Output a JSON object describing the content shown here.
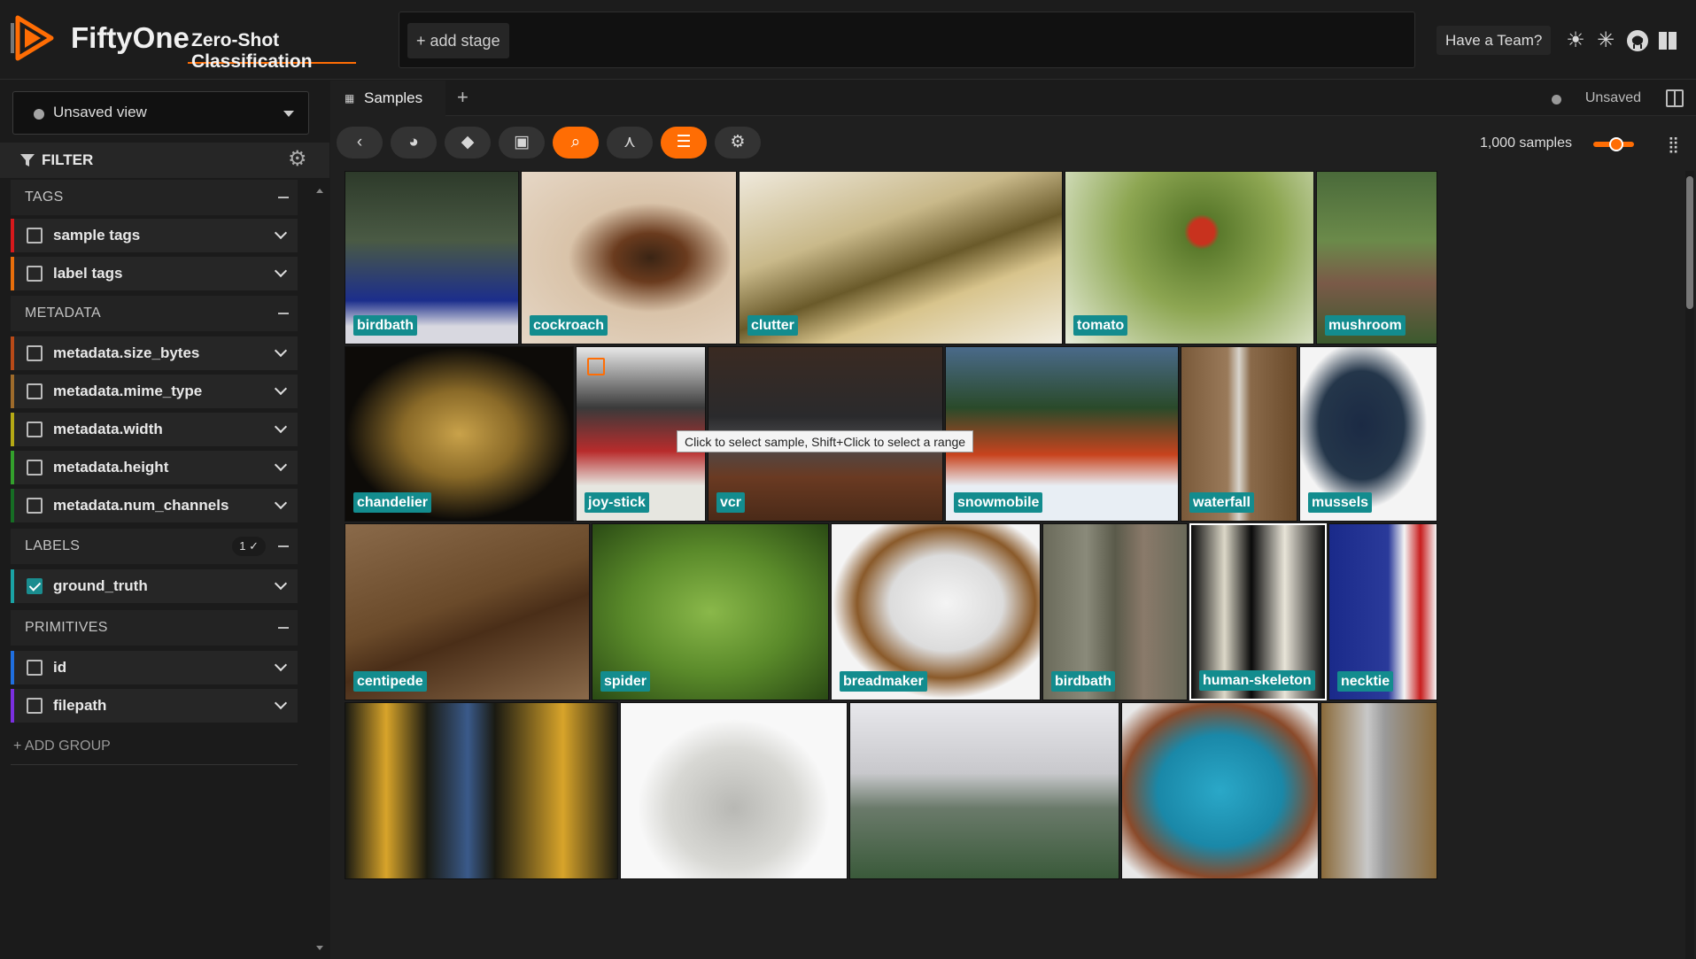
{
  "app": {
    "name": "FiftyOne",
    "dataset": "Zero-Shot Classification",
    "add_stage": "+ add stage",
    "team_button": "Have a Team?",
    "icons": [
      "sun-icon",
      "slack-icon",
      "github-icon",
      "docs-icon"
    ]
  },
  "sidebar": {
    "view_selector": "Unsaved view",
    "filter_label": "FILTER",
    "groups": [
      {
        "title": "TAGS",
        "fields": [
          {
            "label": "sample tags",
            "color": "#d7191c",
            "checked": false
          },
          {
            "label": "label tags",
            "color": "#e96f0c",
            "checked": false
          }
        ]
      },
      {
        "title": "METADATA",
        "fields": [
          {
            "label": "metadata.size_bytes",
            "color": "#b94a18",
            "checked": false
          },
          {
            "label": "metadata.mime_type",
            "color": "#9e6b2b",
            "checked": false
          },
          {
            "label": "metadata.width",
            "color": "#b5a915",
            "checked": false
          },
          {
            "label": "metadata.height",
            "color": "#33a02c",
            "checked": false
          },
          {
            "label": "metadata.num_channels",
            "color": "#166d24",
            "checked": false
          }
        ]
      },
      {
        "title": "LABELS",
        "badge": "1 ✓",
        "fields": [
          {
            "label": "ground_truth",
            "color": "#1aa3a5",
            "checked": true
          }
        ]
      },
      {
        "title": "PRIMITIVES",
        "fields": [
          {
            "label": "id",
            "color": "#1f6fe0",
            "checked": false
          },
          {
            "label": "filepath",
            "color": "#7b2fe0",
            "checked": false
          }
        ]
      }
    ],
    "add_group": "+ ADD GROUP"
  },
  "main": {
    "tab_label": "Samples",
    "tab_add": "+",
    "unsaved_label": "Unsaved",
    "sample_count": "1,000 samples",
    "tooltip": "Click to select sample, Shift+Click to select a range",
    "tiles": [
      {
        "label": "birdbath"
      },
      {
        "label": "cockroach"
      },
      {
        "label": "clutter"
      },
      {
        "label": "tomato"
      },
      {
        "label": "mushroom"
      },
      {
        "label": "chandelier"
      },
      {
        "label": "joy-stick"
      },
      {
        "label": "vcr"
      },
      {
        "label": "snowmobile"
      },
      {
        "label": "waterfall"
      },
      {
        "label": "mussels"
      },
      {
        "label": "centipede"
      },
      {
        "label": "spider"
      },
      {
        "label": "breadmaker"
      },
      {
        "label": "birdbath"
      },
      {
        "label": "human-skeleton"
      },
      {
        "label": "necktie"
      }
    ]
  }
}
